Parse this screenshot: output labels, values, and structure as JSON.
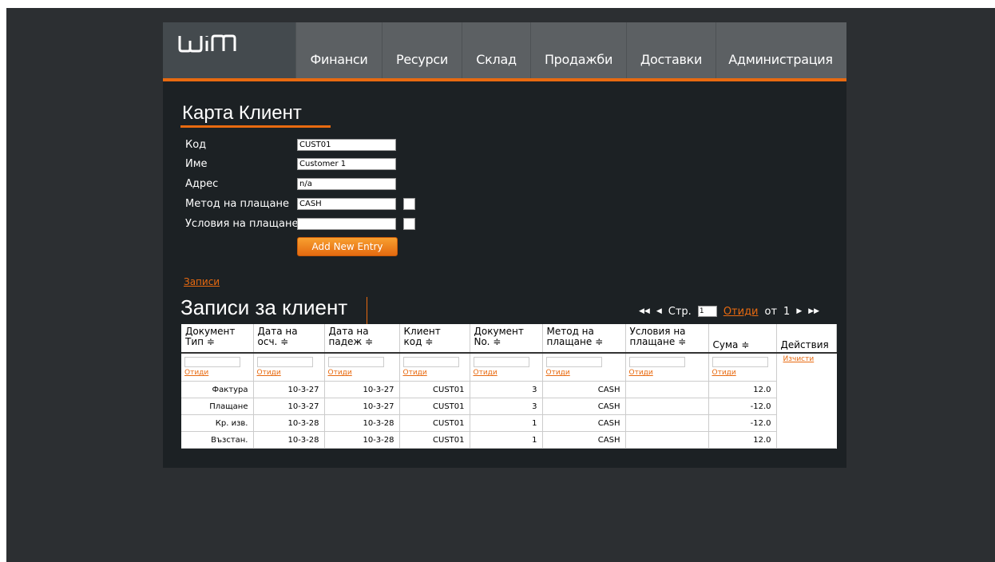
{
  "app": {
    "logo_text": "WIM"
  },
  "nav": {
    "items": [
      {
        "label": "Финанси"
      },
      {
        "label": "Ресурси"
      },
      {
        "label": "Склад"
      },
      {
        "label": "Продажби"
      },
      {
        "label": "Доставки"
      },
      {
        "label": "Администрация"
      }
    ]
  },
  "card": {
    "title": "Карта Клиент",
    "fields": {
      "code": {
        "label": "Код",
        "value": "CUST01"
      },
      "name": {
        "label": "Име",
        "value": "Customer 1"
      },
      "address": {
        "label": "Адрес",
        "value": "n/a"
      },
      "payment_method": {
        "label": "Метод на плащане",
        "value": "CASH"
      },
      "payment_terms": {
        "label": "Условия на плащане",
        "value": ""
      }
    },
    "add_button": "Add New Entry",
    "records_link": "Записи"
  },
  "records": {
    "title": "Записи за клиент",
    "pager": {
      "first_icon": "first-page-icon",
      "prev_icon": "prev-page-icon",
      "next_icon": "next-page-icon",
      "last_icon": "last-page-icon",
      "page_label": "Стр.",
      "page_value": "1",
      "go_link": "Отиди",
      "of_label": "от",
      "total_pages": "1"
    },
    "columns": [
      {
        "line1": "Документ",
        "line2": "Тип ≑"
      },
      {
        "line1": "Дата на",
        "line2": "осч. ≑"
      },
      {
        "line1": "Дата на",
        "line2": "падеж ≑"
      },
      {
        "line1": "Клиент",
        "line2": "код ≑"
      },
      {
        "line1": "Документ",
        "line2": "No. ≑"
      },
      {
        "line1": "Метод на",
        "line2": "плащане ≑"
      },
      {
        "line1": "Условия на",
        "line2": "плащане ≑"
      },
      {
        "line1": "",
        "line2": "Сума ≑"
      },
      {
        "line1": "",
        "line2": "Действия"
      }
    ],
    "filter_link": "Отиди",
    "clear_link": "Изчисти",
    "rows": [
      [
        "Фактура",
        "10-3-27",
        "10-3-27",
        "CUST01",
        "3",
        "CASH",
        "",
        "12.0"
      ],
      [
        "Плащане",
        "10-3-27",
        "10-3-27",
        "CUST01",
        "3",
        "CASH",
        "",
        "-12.0"
      ],
      [
        "Кр. изв.",
        "10-3-28",
        "10-3-28",
        "CUST01",
        "1",
        "CASH",
        "",
        "-12.0"
      ],
      [
        "Възстан.",
        "10-3-28",
        "10-3-28",
        "CUST01",
        "1",
        "CASH",
        "",
        "12.0"
      ]
    ]
  },
  "colors": {
    "accent": "#e86a10",
    "nav_bg": "#5c6063",
    "panel_bg": "#1c2124",
    "page_bg": "#2c2f32"
  }
}
